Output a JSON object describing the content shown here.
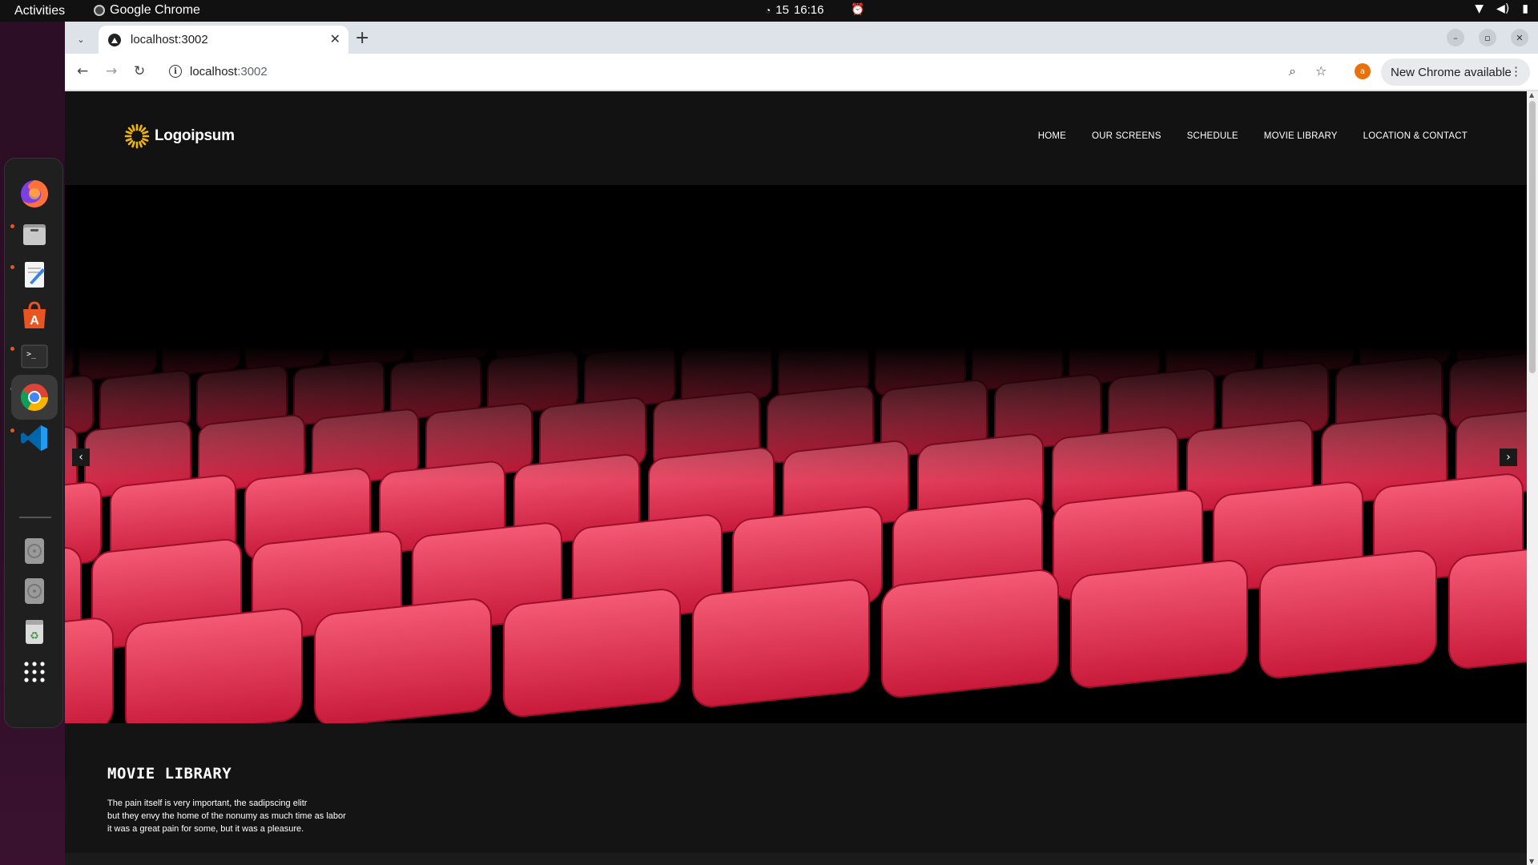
{
  "system": {
    "activities": "Activities",
    "app_name": "Google Chrome",
    "date": "15",
    "time": "16:16"
  },
  "dock": {
    "apps": [
      {
        "name": "firefox-icon",
        "color": "#e66000"
      },
      {
        "name": "files-icon",
        "color": "#888888"
      },
      {
        "name": "text-editor-icon",
        "color": "#f5f5f5"
      },
      {
        "name": "app-center-icon",
        "color": "#e95420"
      },
      {
        "name": "terminal-icon",
        "color": "#2b2b2b"
      },
      {
        "name": "chrome-icon",
        "color": "#4285f4"
      },
      {
        "name": "vscode-icon",
        "color": "#007acc"
      },
      {
        "name": "disc-drive-icon",
        "color": "#9a9a9a"
      },
      {
        "name": "disc-drive-icon",
        "color": "#9a9a9a"
      },
      {
        "name": "trash-icon",
        "color": "#5aa05a"
      },
      {
        "name": "app-grid-icon",
        "color": "#ffffff"
      }
    ]
  },
  "browser": {
    "tab_title": "localhost:3002",
    "url_host": "localhost",
    "url_port": ":3002",
    "update_label": "New Chrome available",
    "profile_initial": "a"
  },
  "site": {
    "logo_text": "Logoipsum",
    "nav": [
      "HOME",
      "OUR SCREENS",
      "SCHEDULE",
      "MOVIE LIBRARY",
      "LOCATION & CONTACT"
    ],
    "hero": {
      "prev_label": "‹",
      "next_label": "›",
      "seat_color": "#e02848"
    },
    "library": {
      "heading": "MOVIE LIBRARY",
      "lines": [
        "The pain itself is very important, the sadipscing elitr",
        "but they envy the home of the nonumy as much time as labor",
        "it was a great pain for some, but it was a pleasure."
      ]
    }
  }
}
